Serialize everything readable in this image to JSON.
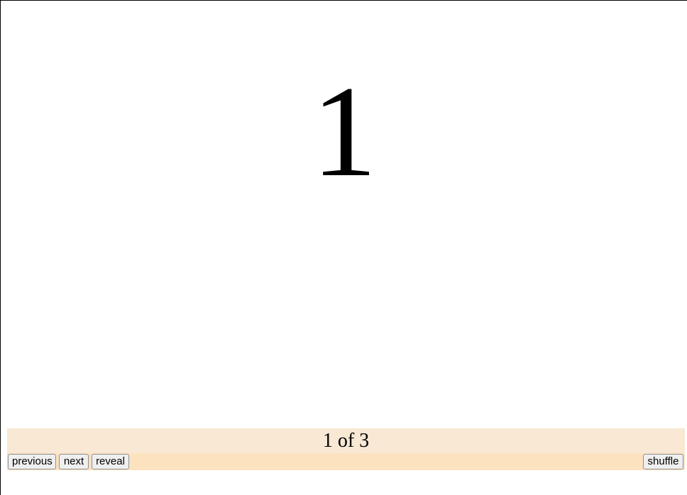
{
  "card": {
    "value": "1"
  },
  "progress": {
    "label": "1 of 3",
    "current": 1,
    "total": 3
  },
  "controls": {
    "previous_label": "previous",
    "next_label": "next",
    "reveal_label": "reveal",
    "shuffle_label": "shuffle"
  },
  "colors": {
    "counter_background": "#f8e8d4",
    "controls_background": "#fde2c0",
    "button_background": "#efefef",
    "text": "#000000"
  }
}
